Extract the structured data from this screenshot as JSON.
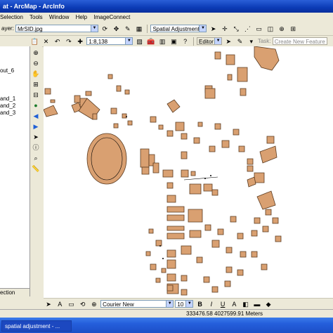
{
  "window": {
    "title": "at - ArcMap - ArcInfo"
  },
  "menu": {
    "items": [
      "Selection",
      "Tools",
      "Window",
      "Help",
      "ImageConnect"
    ]
  },
  "toolbar1": {
    "layer_label": "ayer:",
    "layer_value": "MrSID.jpg",
    "spatial_adjustment": "Spatial Adjustment"
  },
  "toolbar2": {
    "scale_value": "1:8,138",
    "editor_label": "Editor",
    "task_label": "Task:",
    "task_value": "Create New Feature"
  },
  "toc": {
    "items": [
      "out_6",
      "and_1",
      "and_2",
      "and_3"
    ],
    "bottom_tab": "ection"
  },
  "drawing": {
    "font_value": "Courier New",
    "size_value": "10",
    "bold": "B",
    "italic": "I",
    "underline": "U",
    "font_color": "A"
  },
  "status": {
    "coordinates": "333476.58  4027599.91 Meters"
  },
  "taskbar": {
    "task_label": "spatial adjustment - ..."
  },
  "colors": {
    "feature_fill": "#d9a071",
    "feature_stroke": "#5a3a1f"
  }
}
